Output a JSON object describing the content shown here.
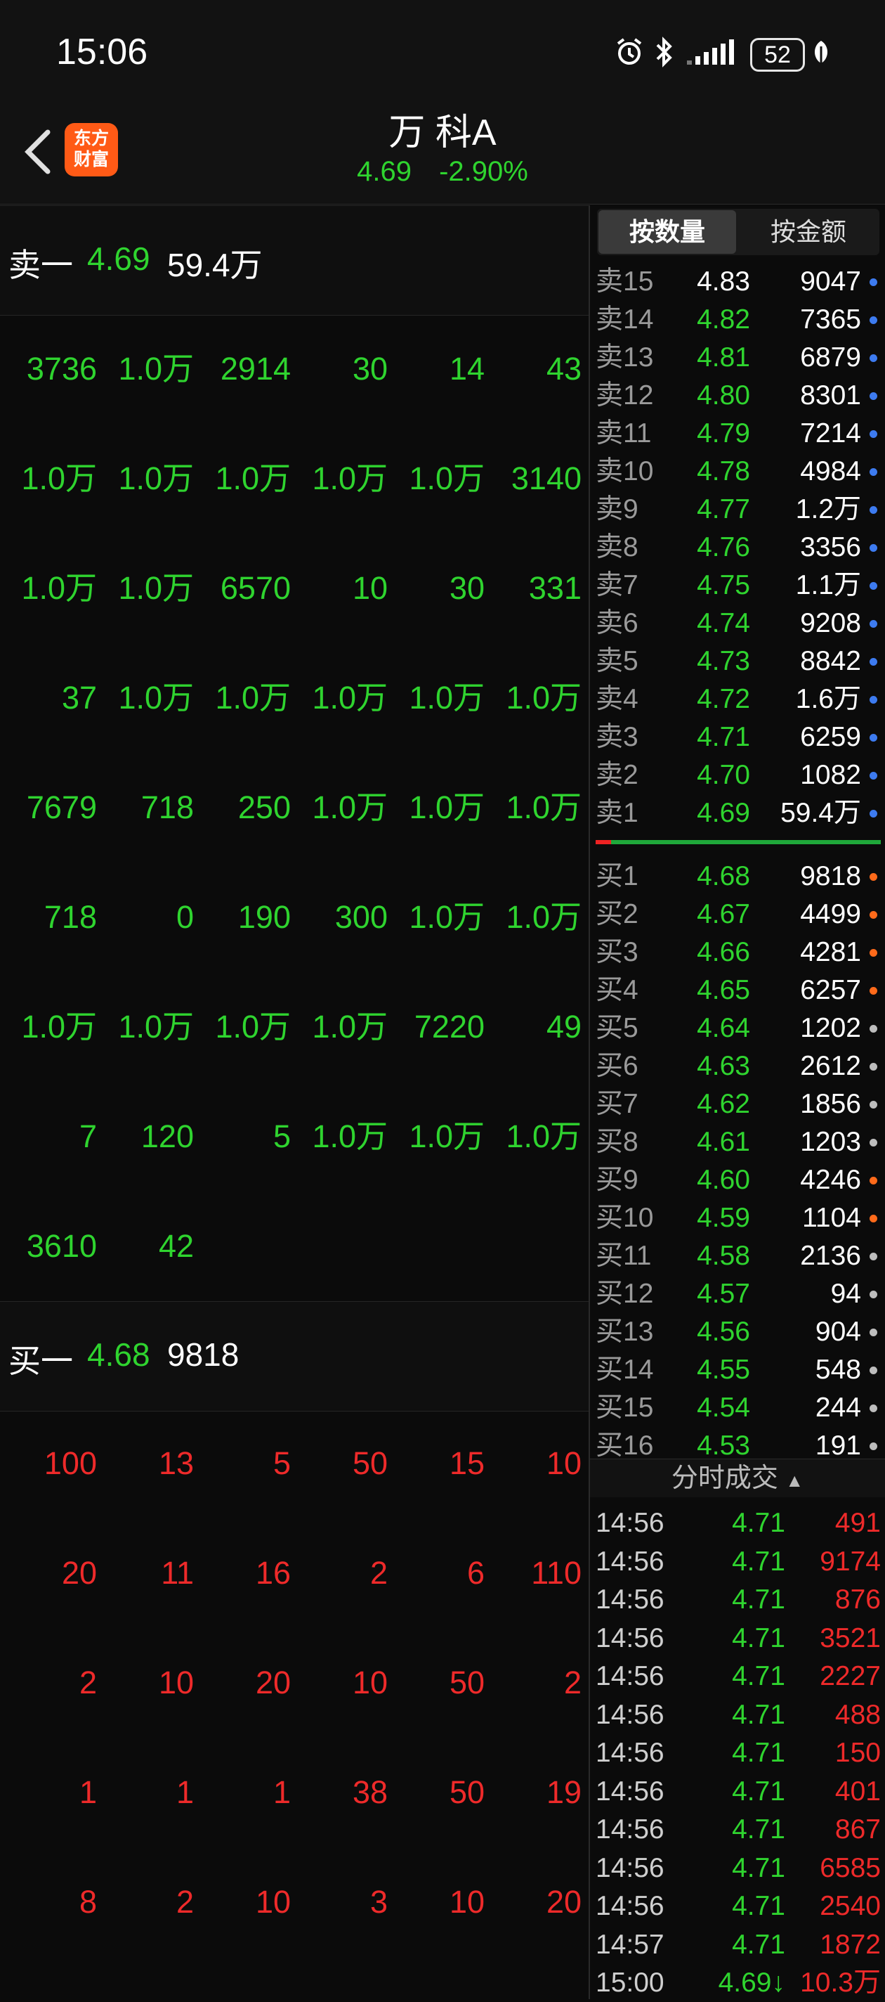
{
  "status_bar": {
    "time": "15:06",
    "battery": "52"
  },
  "header": {
    "logo_text_line1": "东方",
    "logo_text_line2": "财富",
    "title": "万  科A",
    "price": "4.69",
    "change_pct": "-2.90%"
  },
  "left_panel": {
    "sell1": {
      "label": "卖一",
      "price": "4.69",
      "volume": "59.4万"
    },
    "sell1_orders": [
      [
        "3736",
        "1.0万",
        "2914",
        "30",
        "14",
        "43"
      ],
      [
        "1.0万",
        "1.0万",
        "1.0万",
        "1.0万",
        "1.0万",
        "3140"
      ],
      [
        "1.0万",
        "1.0万",
        "6570",
        "10",
        "30",
        "331"
      ],
      [
        "37",
        "1.0万",
        "1.0万",
        "1.0万",
        "1.0万",
        "1.0万"
      ],
      [
        "7679",
        "718",
        "250",
        "1.0万",
        "1.0万",
        "1.0万"
      ],
      [
        "718",
        "0",
        "190",
        "300",
        "1.0万",
        "1.0万"
      ],
      [
        "1.0万",
        "1.0万",
        "1.0万",
        "1.0万",
        "7220",
        "49"
      ],
      [
        "7",
        "120",
        "5",
        "1.0万",
        "1.0万",
        "1.0万"
      ],
      [
        "3610",
        "42",
        "",
        "",
        "",
        ""
      ]
    ],
    "buy1": {
      "label": "买一",
      "price": "4.68",
      "volume": "9818"
    },
    "buy1_orders": [
      [
        "100",
        "13",
        "5",
        "50",
        "15",
        "10"
      ],
      [
        "20",
        "11",
        "16",
        "2",
        "6",
        "110"
      ],
      [
        "2",
        "10",
        "20",
        "10",
        "50",
        "2"
      ],
      [
        "1",
        "1",
        "1",
        "38",
        "50",
        "19"
      ],
      [
        "8",
        "2",
        "10",
        "3",
        "10",
        "20"
      ]
    ]
  },
  "right_panel": {
    "tabs": {
      "by_quantity": "按数量",
      "by_amount": "按金额"
    },
    "colors": {
      "orange": "#ff6a1a",
      "blue": "#3d7bf0",
      "gray": "#bdbdbd",
      "green": "#2fd42f",
      "red": "#ee2a2a"
    },
    "asks": [
      {
        "label": "卖15",
        "price": "4.83",
        "volume": "9047",
        "dot": "blue"
      },
      {
        "label": "卖14",
        "price": "4.82",
        "volume": "7365",
        "dot": "blue"
      },
      {
        "label": "卖13",
        "price": "4.81",
        "volume": "6879",
        "dot": "blue"
      },
      {
        "label": "卖12",
        "price": "4.80",
        "volume": "8301",
        "dot": "blue"
      },
      {
        "label": "卖11",
        "price": "4.79",
        "volume": "7214",
        "dot": "blue"
      },
      {
        "label": "卖10",
        "price": "4.78",
        "volume": "4984",
        "dot": "blue"
      },
      {
        "label": "卖9",
        "price": "4.77",
        "volume": "1.2万",
        "dot": "blue"
      },
      {
        "label": "卖8",
        "price": "4.76",
        "volume": "3356",
        "dot": "blue"
      },
      {
        "label": "卖7",
        "price": "4.75",
        "volume": "1.1万",
        "dot": "blue"
      },
      {
        "label": "卖6",
        "price": "4.74",
        "volume": "9208",
        "dot": "blue"
      },
      {
        "label": "卖5",
        "price": "4.73",
        "volume": "8842",
        "dot": "blue"
      },
      {
        "label": "卖4",
        "price": "4.72",
        "volume": "1.6万",
        "dot": "blue"
      },
      {
        "label": "卖3",
        "price": "4.71",
        "volume": "6259",
        "dot": "blue"
      },
      {
        "label": "卖2",
        "price": "4.70",
        "volume": "1082",
        "dot": "blue"
      },
      {
        "label": "卖1",
        "price": "4.69",
        "volume": "59.4万",
        "dot": "blue"
      }
    ],
    "bids": [
      {
        "label": "买1",
        "price": "4.68",
        "volume": "9818",
        "dot": "orange"
      },
      {
        "label": "买2",
        "price": "4.67",
        "volume": "4499",
        "dot": "orange"
      },
      {
        "label": "买3",
        "price": "4.66",
        "volume": "4281",
        "dot": "orange"
      },
      {
        "label": "买4",
        "price": "4.65",
        "volume": "6257",
        "dot": "orange"
      },
      {
        "label": "买5",
        "price": "4.64",
        "volume": "1202",
        "dot": "gray"
      },
      {
        "label": "买6",
        "price": "4.63",
        "volume": "2612",
        "dot": "gray"
      },
      {
        "label": "买7",
        "price": "4.62",
        "volume": "1856",
        "dot": "gray"
      },
      {
        "label": "买8",
        "price": "4.61",
        "volume": "1203",
        "dot": "gray"
      },
      {
        "label": "买9",
        "price": "4.60",
        "volume": "4246",
        "dot": "orange"
      },
      {
        "label": "买10",
        "price": "4.59",
        "volume": "1104",
        "dot": "orange"
      },
      {
        "label": "买11",
        "price": "4.58",
        "volume": "2136",
        "dot": "gray"
      },
      {
        "label": "买12",
        "price": "4.57",
        "volume": "94",
        "dot": "gray"
      },
      {
        "label": "买13",
        "price": "4.56",
        "volume": "904",
        "dot": "gray"
      },
      {
        "label": "买14",
        "price": "4.55",
        "volume": "548",
        "dot": "gray"
      },
      {
        "label": "买15",
        "price": "4.54",
        "volume": "244",
        "dot": "gray"
      },
      {
        "label": "买16",
        "price": "4.53",
        "volume": "191",
        "dot": "gray"
      }
    ],
    "ticks_header": "分时成交",
    "ticks": [
      {
        "time": "14:56",
        "price": "4.71",
        "volume": "491"
      },
      {
        "time": "14:56",
        "price": "4.71",
        "volume": "9174"
      },
      {
        "time": "14:56",
        "price": "4.71",
        "volume": "876"
      },
      {
        "time": "14:56",
        "price": "4.71",
        "volume": "3521"
      },
      {
        "time": "14:56",
        "price": "4.71",
        "volume": "2227"
      },
      {
        "time": "14:56",
        "price": "4.71",
        "volume": "488"
      },
      {
        "time": "14:56",
        "price": "4.71",
        "volume": "150"
      },
      {
        "time": "14:56",
        "price": "4.71",
        "volume": "401"
      },
      {
        "time": "14:56",
        "price": "4.71",
        "volume": "867"
      },
      {
        "time": "14:56",
        "price": "4.71",
        "volume": "6585"
      },
      {
        "time": "14:56",
        "price": "4.71",
        "volume": "2540"
      },
      {
        "time": "14:57",
        "price": "4.71",
        "volume": "1872"
      },
      {
        "time": "15:00",
        "price": "4.69↓",
        "volume": "10.3万"
      }
    ]
  }
}
